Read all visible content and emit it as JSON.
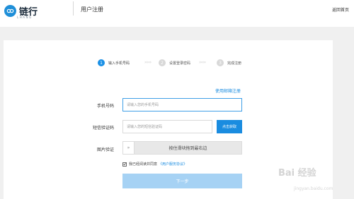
{
  "header": {
    "logo_name": "链行",
    "logo_sub": "LHANG",
    "page_title": "用户注册",
    "home_link": "返回首页"
  },
  "steps": [
    {
      "num": "1",
      "label": "输入手机号码",
      "active": true
    },
    {
      "num": "2",
      "label": "设置登录密码",
      "active": false
    },
    {
      "num": "3",
      "label": "完成注册",
      "active": false
    }
  ],
  "step_arrows": "›››››",
  "form": {
    "email_link": "使用邮箱注册",
    "phone_label": "手机号码",
    "phone_placeholder": "请输入您的手机号码",
    "sms_label": "短信验证码",
    "sms_placeholder": "请输入您的短信验证码",
    "sms_button": "点击获取",
    "captcha_label": "图片验证",
    "slider_handle": "»",
    "slider_text": "按住滑块拖到最右边",
    "agree_text": "我已经阅读并同意",
    "agree_link": "《用户服务协议》",
    "next_button": "下一步"
  },
  "colors": {
    "accent": "#1a8ce0",
    "disabled_button": "#a6d2f4"
  },
  "watermark": {
    "text": "Bai 经验",
    "sub": "jingyan.baidu.com"
  }
}
